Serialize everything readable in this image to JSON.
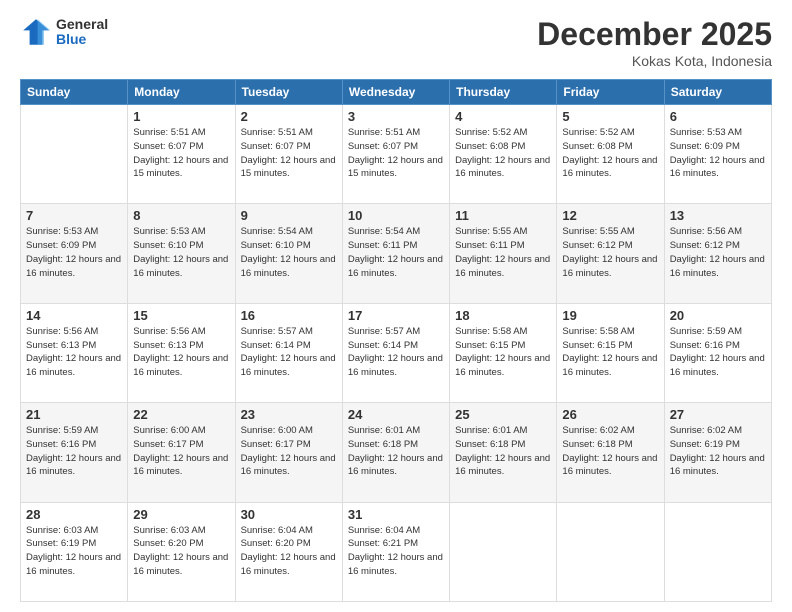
{
  "logo": {
    "general": "General",
    "blue": "Blue"
  },
  "title": {
    "month": "December 2025",
    "location": "Kokas Kota, Indonesia"
  },
  "weekdays": [
    "Sunday",
    "Monday",
    "Tuesday",
    "Wednesday",
    "Thursday",
    "Friday",
    "Saturday"
  ],
  "weeks": [
    [
      {
        "day": "",
        "sunrise": "",
        "sunset": "",
        "daylight": ""
      },
      {
        "day": "1",
        "sunrise": "Sunrise: 5:51 AM",
        "sunset": "Sunset: 6:07 PM",
        "daylight": "Daylight: 12 hours and 15 minutes."
      },
      {
        "day": "2",
        "sunrise": "Sunrise: 5:51 AM",
        "sunset": "Sunset: 6:07 PM",
        "daylight": "Daylight: 12 hours and 15 minutes."
      },
      {
        "day": "3",
        "sunrise": "Sunrise: 5:51 AM",
        "sunset": "Sunset: 6:07 PM",
        "daylight": "Daylight: 12 hours and 15 minutes."
      },
      {
        "day": "4",
        "sunrise": "Sunrise: 5:52 AM",
        "sunset": "Sunset: 6:08 PM",
        "daylight": "Daylight: 12 hours and 16 minutes."
      },
      {
        "day": "5",
        "sunrise": "Sunrise: 5:52 AM",
        "sunset": "Sunset: 6:08 PM",
        "daylight": "Daylight: 12 hours and 16 minutes."
      },
      {
        "day": "6",
        "sunrise": "Sunrise: 5:53 AM",
        "sunset": "Sunset: 6:09 PM",
        "daylight": "Daylight: 12 hours and 16 minutes."
      }
    ],
    [
      {
        "day": "7",
        "sunrise": "Sunrise: 5:53 AM",
        "sunset": "Sunset: 6:09 PM",
        "daylight": "Daylight: 12 hours and 16 minutes."
      },
      {
        "day": "8",
        "sunrise": "Sunrise: 5:53 AM",
        "sunset": "Sunset: 6:10 PM",
        "daylight": "Daylight: 12 hours and 16 minutes."
      },
      {
        "day": "9",
        "sunrise": "Sunrise: 5:54 AM",
        "sunset": "Sunset: 6:10 PM",
        "daylight": "Daylight: 12 hours and 16 minutes."
      },
      {
        "day": "10",
        "sunrise": "Sunrise: 5:54 AM",
        "sunset": "Sunset: 6:11 PM",
        "daylight": "Daylight: 12 hours and 16 minutes."
      },
      {
        "day": "11",
        "sunrise": "Sunrise: 5:55 AM",
        "sunset": "Sunset: 6:11 PM",
        "daylight": "Daylight: 12 hours and 16 minutes."
      },
      {
        "day": "12",
        "sunrise": "Sunrise: 5:55 AM",
        "sunset": "Sunset: 6:12 PM",
        "daylight": "Daylight: 12 hours and 16 minutes."
      },
      {
        "day": "13",
        "sunrise": "Sunrise: 5:56 AM",
        "sunset": "Sunset: 6:12 PM",
        "daylight": "Daylight: 12 hours and 16 minutes."
      }
    ],
    [
      {
        "day": "14",
        "sunrise": "Sunrise: 5:56 AM",
        "sunset": "Sunset: 6:13 PM",
        "daylight": "Daylight: 12 hours and 16 minutes."
      },
      {
        "day": "15",
        "sunrise": "Sunrise: 5:56 AM",
        "sunset": "Sunset: 6:13 PM",
        "daylight": "Daylight: 12 hours and 16 minutes."
      },
      {
        "day": "16",
        "sunrise": "Sunrise: 5:57 AM",
        "sunset": "Sunset: 6:14 PM",
        "daylight": "Daylight: 12 hours and 16 minutes."
      },
      {
        "day": "17",
        "sunrise": "Sunrise: 5:57 AM",
        "sunset": "Sunset: 6:14 PM",
        "daylight": "Daylight: 12 hours and 16 minutes."
      },
      {
        "day": "18",
        "sunrise": "Sunrise: 5:58 AM",
        "sunset": "Sunset: 6:15 PM",
        "daylight": "Daylight: 12 hours and 16 minutes."
      },
      {
        "day": "19",
        "sunrise": "Sunrise: 5:58 AM",
        "sunset": "Sunset: 6:15 PM",
        "daylight": "Daylight: 12 hours and 16 minutes."
      },
      {
        "day": "20",
        "sunrise": "Sunrise: 5:59 AM",
        "sunset": "Sunset: 6:16 PM",
        "daylight": "Daylight: 12 hours and 16 minutes."
      }
    ],
    [
      {
        "day": "21",
        "sunrise": "Sunrise: 5:59 AM",
        "sunset": "Sunset: 6:16 PM",
        "daylight": "Daylight: 12 hours and 16 minutes."
      },
      {
        "day": "22",
        "sunrise": "Sunrise: 6:00 AM",
        "sunset": "Sunset: 6:17 PM",
        "daylight": "Daylight: 12 hours and 16 minutes."
      },
      {
        "day": "23",
        "sunrise": "Sunrise: 6:00 AM",
        "sunset": "Sunset: 6:17 PM",
        "daylight": "Daylight: 12 hours and 16 minutes."
      },
      {
        "day": "24",
        "sunrise": "Sunrise: 6:01 AM",
        "sunset": "Sunset: 6:18 PM",
        "daylight": "Daylight: 12 hours and 16 minutes."
      },
      {
        "day": "25",
        "sunrise": "Sunrise: 6:01 AM",
        "sunset": "Sunset: 6:18 PM",
        "daylight": "Daylight: 12 hours and 16 minutes."
      },
      {
        "day": "26",
        "sunrise": "Sunrise: 6:02 AM",
        "sunset": "Sunset: 6:18 PM",
        "daylight": "Daylight: 12 hours and 16 minutes."
      },
      {
        "day": "27",
        "sunrise": "Sunrise: 6:02 AM",
        "sunset": "Sunset: 6:19 PM",
        "daylight": "Daylight: 12 hours and 16 minutes."
      }
    ],
    [
      {
        "day": "28",
        "sunrise": "Sunrise: 6:03 AM",
        "sunset": "Sunset: 6:19 PM",
        "daylight": "Daylight: 12 hours and 16 minutes."
      },
      {
        "day": "29",
        "sunrise": "Sunrise: 6:03 AM",
        "sunset": "Sunset: 6:20 PM",
        "daylight": "Daylight: 12 hours and 16 minutes."
      },
      {
        "day": "30",
        "sunrise": "Sunrise: 6:04 AM",
        "sunset": "Sunset: 6:20 PM",
        "daylight": "Daylight: 12 hours and 16 minutes."
      },
      {
        "day": "31",
        "sunrise": "Sunrise: 6:04 AM",
        "sunset": "Sunset: 6:21 PM",
        "daylight": "Daylight: 12 hours and 16 minutes."
      },
      {
        "day": "",
        "sunrise": "",
        "sunset": "",
        "daylight": ""
      },
      {
        "day": "",
        "sunrise": "",
        "sunset": "",
        "daylight": ""
      },
      {
        "day": "",
        "sunrise": "",
        "sunset": "",
        "daylight": ""
      }
    ]
  ]
}
